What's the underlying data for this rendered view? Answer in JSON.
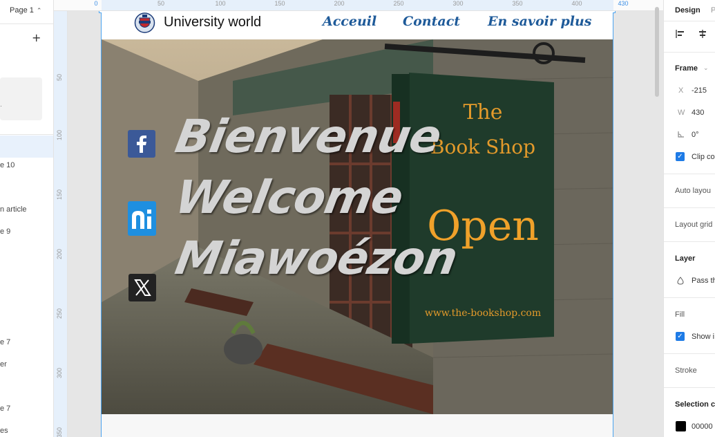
{
  "colors": {
    "selection": "#4aa3f0",
    "nav_link": "#1e5a99",
    "checkbox": "#1e7be6",
    "facebook": "#3b5998",
    "ni": "#1e8fe0"
  },
  "left_panel": {
    "page_selector": "Page 1",
    "add_label": "+",
    "layers": [
      "e 10",
      "n article",
      "e 9",
      "e 7",
      "er",
      "e 7",
      "es"
    ]
  },
  "rulers": {
    "top": [
      "0",
      "50",
      "100",
      "150",
      "200",
      "250",
      "300",
      "350",
      "400",
      "430"
    ],
    "left": [
      "50",
      "100",
      "150",
      "200",
      "250",
      "300",
      "350"
    ]
  },
  "site": {
    "title": "University world",
    "nav": [
      "Acceuil",
      "Contact",
      "En savoir plus"
    ],
    "hero_lines": [
      "Bienvenue",
      "Welcome",
      "Miawoézon"
    ],
    "sign": {
      "line1": "The",
      "line2": "Book Shop",
      "line3": "Open",
      "url": "www.the-bookshop.com"
    },
    "social_icons": [
      "facebook-icon",
      "ni-icon",
      "x-icon"
    ]
  },
  "right_panel": {
    "tab_design": "Design",
    "tab_other": "P",
    "frame_title": "Frame",
    "x_label": "X",
    "x_value": "-215",
    "w_label": "W",
    "w_value": "430",
    "rotation_value": "0°",
    "clip_content": "Clip co",
    "auto_layout": "Auto layou",
    "layout_grid": "Layout grid",
    "layer_title": "Layer",
    "pass_through": "Pass th",
    "fill_title": "Fill",
    "show_in_exports": "Show i",
    "stroke_title": "Stroke",
    "selection_colors": "Selection c",
    "selection_hex": "00000"
  }
}
